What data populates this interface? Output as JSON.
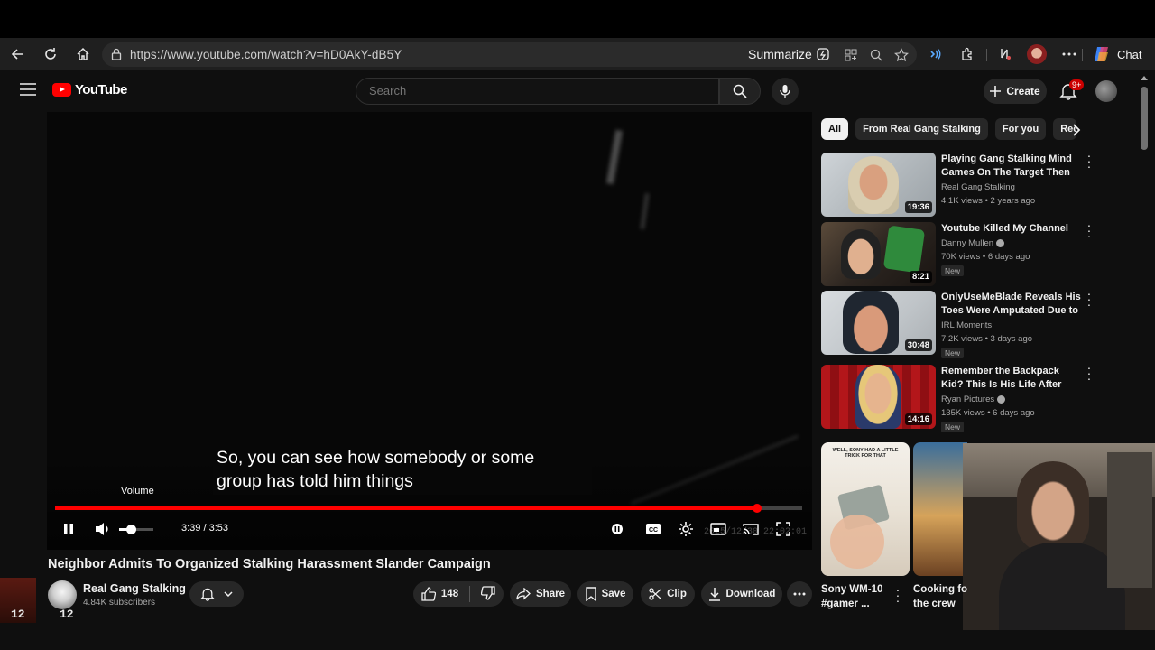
{
  "browser": {
    "url": "https://www.youtube.com/watch?v=hD0AkY-dB5Y",
    "summarize_label": "Summarize",
    "chat_label": "Chat"
  },
  "youtube": {
    "logo_text": "YouTube",
    "search_placeholder": "Search",
    "create_label": "Create",
    "notif_badge": "9+"
  },
  "player": {
    "caption_line1": "So, you can see how somebody or some",
    "caption_line2": "group has told him things",
    "volume_tooltip": "Volume",
    "time": "3:39 / 3:53",
    "progress": 0.94,
    "volume_level": 0.35,
    "stamp": "2025/12/30  22:02:01"
  },
  "video": {
    "title": "Neighbor Admits To Organized Stalking Harassment Slander Campaign",
    "channel_name": "Real Gang Stalking",
    "subscribers": "4.84K subscribers",
    "likes": "148",
    "share_label": "Share",
    "save_label": "Save",
    "clip_label": "Clip",
    "download_label": "Download"
  },
  "overlay": {
    "cam_number_1": "12",
    "cam_number_2": "12"
  },
  "chips": [
    "All",
    "From Real Gang Stalking",
    "For you",
    "Rec"
  ],
  "recommendations": [
    {
      "title": "Playing Gang Stalking Mind Games On The Target Then Ac...",
      "channel": "Real Gang Stalking",
      "meta": "4.1K views • 2 years ago",
      "duration": "19:36",
      "verified": false,
      "new": false
    },
    {
      "title": "Youtube Killed My Channel",
      "channel": "Danny Mullen",
      "meta": "70K views • 6 days ago",
      "duration": "8:21",
      "verified": true,
      "new": true,
      "new_label": "New"
    },
    {
      "title": "OnlyUseMeBlade Reveals His Toes Were Amputated Due to ...",
      "channel": "IRL Moments",
      "meta": "7.2K views • 3 days ago",
      "duration": "30:48",
      "verified": false,
      "new": true,
      "new_label": "New"
    },
    {
      "title": "Remember the Backpack Kid? This Is His Life After Fame.",
      "channel": "Ryan Pictures",
      "meta": "135K views • 6 days ago",
      "duration": "14:16",
      "verified": true,
      "new": true,
      "new_label": "New"
    }
  ],
  "shorts": [
    {
      "title_line1": "Sony WM-10",
      "title_line2": "#gamer ...",
      "thumb_caption": "WELL, SONY HAD A LITTLE TRICK FOR THAT"
    },
    {
      "title_line1": "Cooking fo",
      "title_line2": "the crew"
    }
  ]
}
